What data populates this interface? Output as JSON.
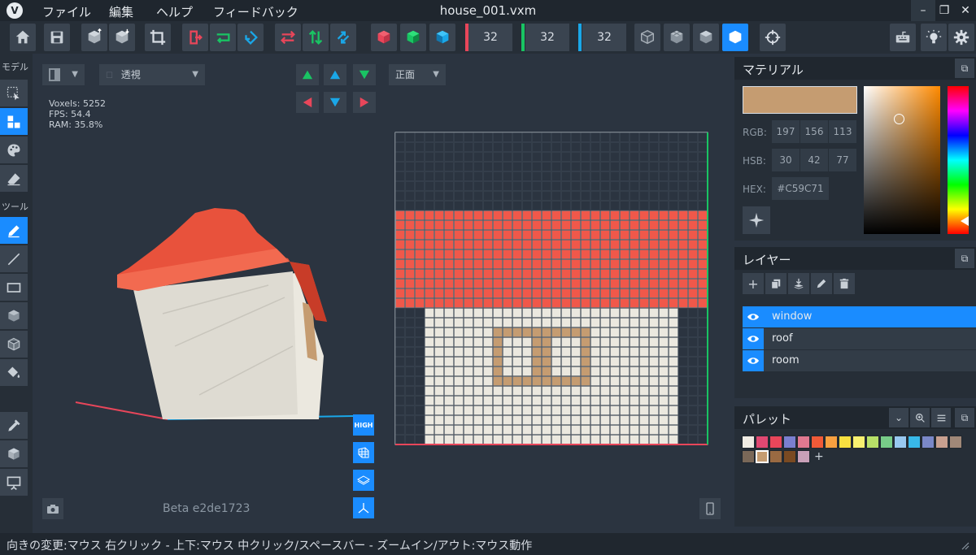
{
  "window": {
    "title": "house_001.vxm",
    "menus": [
      "ファイル",
      "編集",
      "ヘルプ",
      "フィードバック"
    ],
    "controls": {
      "minimize": "–",
      "restore": "❐",
      "close": "✕"
    }
  },
  "toolbar": {
    "size_x": "32",
    "size_y": "32",
    "size_z": "32",
    "axis_colors": {
      "x": "#e8465a",
      "y": "#19c463",
      "z": "#1aa7e8"
    }
  },
  "left_tools": {
    "model_label": "モデル",
    "tool_label": "ツール"
  },
  "viewport": {
    "view_mode_value": "透視",
    "view_mode_prefix": "☐",
    "view_dir_value": "正面",
    "stats": {
      "voxels": "Voxels: 5252",
      "fps": "FPS: 54.4",
      "ram": "RAM: 35.8%"
    },
    "quality_label": "HIGH",
    "beta_label": "Beta e2de1723"
  },
  "material": {
    "title": "マテリアル",
    "swatch_color": "#C59C71",
    "rgb_label": "RGB:",
    "rgb": [
      "197",
      "156",
      "113"
    ],
    "hsb_label": "HSB:",
    "hsb": [
      "30",
      "42",
      "77"
    ],
    "hex_label": "HEX:",
    "hex": "#C59C71"
  },
  "layers": {
    "title": "レイヤー",
    "items": [
      {
        "name": "window",
        "selected": true
      },
      {
        "name": "roof",
        "selected": false
      },
      {
        "name": "room",
        "selected": false
      }
    ]
  },
  "palette": {
    "title": "パレット",
    "add_label": "+",
    "colors": [
      "#f0ece4",
      "#e04872",
      "#e8465a",
      "#7a7fd0",
      "#e07890",
      "#f05a38",
      "#f8a040",
      "#f8e040",
      "#f8f070",
      "#b8e068",
      "#78cc88",
      "#98c8f0",
      "#38b8e8",
      "#7a88c8",
      "#c8a090",
      "#a08878",
      "#7a6858",
      "#c59c71",
      "#9a6a42",
      "#7a4a22",
      "#c8a0b8"
    ],
    "selected_index": 17
  },
  "status": {
    "text": "向きの変更:マウス 右クリック - 上下:マウス 中クリック/スペースバー - ズームイン/アウト:マウス動作"
  }
}
